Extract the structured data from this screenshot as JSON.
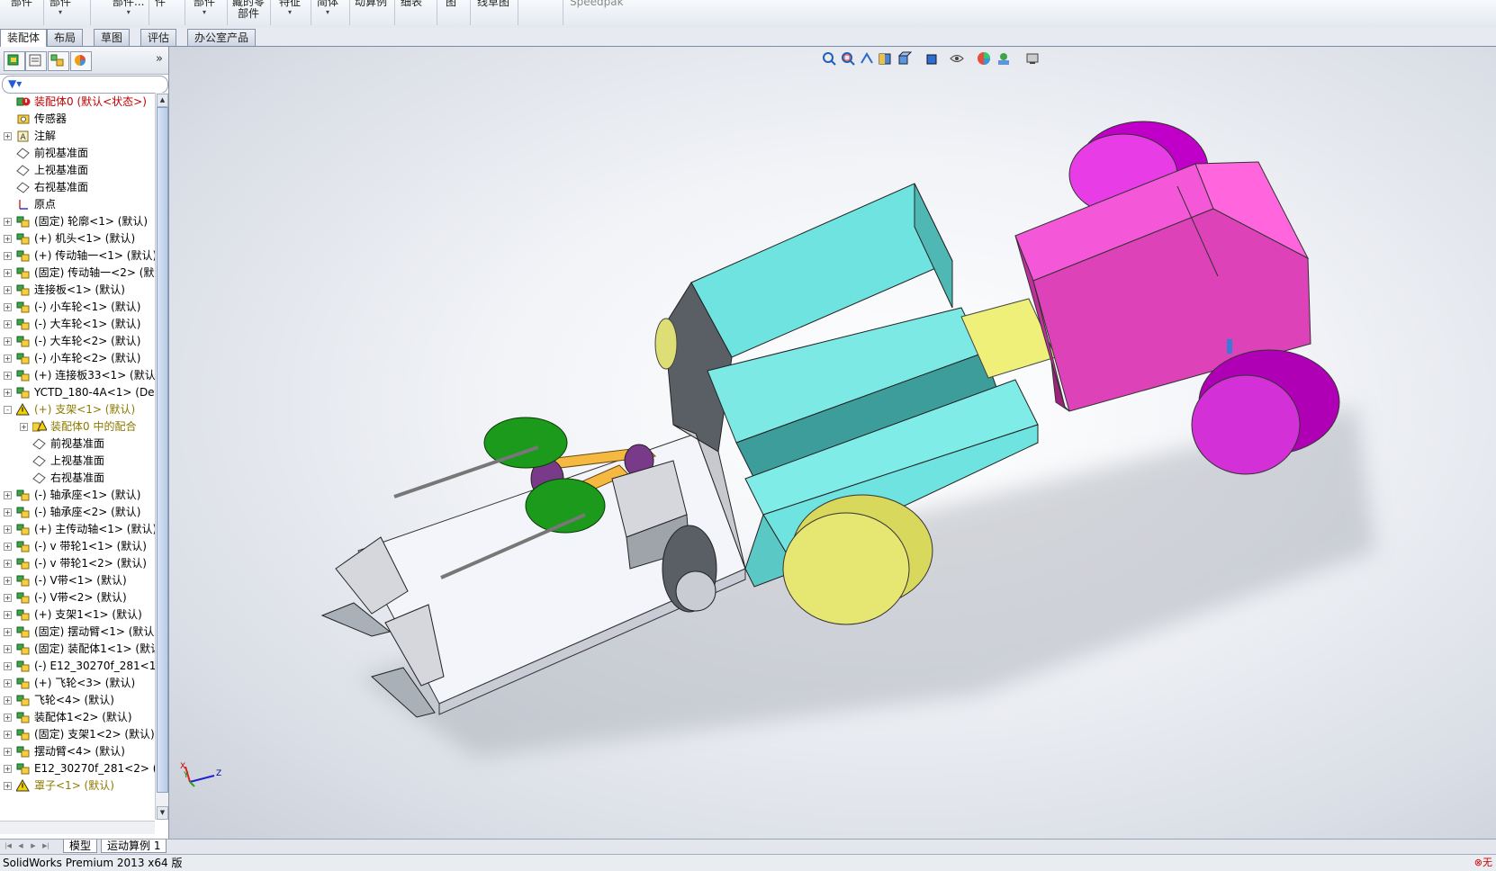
{
  "ribbon": {
    "items": [
      {
        "label": "部件",
        "arrow": ""
      },
      {
        "label": "部件",
        "arrow": "▾"
      },
      {
        "label": "部件...",
        "arrow": "▾"
      },
      {
        "label": "件",
        "arrow": ""
      },
      {
        "label": "部件",
        "arrow": "▾"
      },
      {
        "label": "藏的零\n部件",
        "arrow": ""
      },
      {
        "label": "特征",
        "arrow": "▾"
      },
      {
        "label": "简体",
        "arrow": "▾"
      },
      {
        "label": "动算例",
        "arrow": ""
      },
      {
        "label": "细表",
        "arrow": ""
      },
      {
        "label": "图",
        "arrow": ""
      },
      {
        "label": "线草图",
        "arrow": ""
      },
      {
        "label": "Speedpak",
        "arrow": ""
      }
    ]
  },
  "command_tabs": [
    "装配体",
    "布局",
    "草图",
    "评估",
    "办公室产品"
  ],
  "feature_tree": {
    "rows": [
      {
        "label": "装配体0  (默认<状态>)",
        "icon": "assembly-root-icon",
        "style": "red",
        "expander": ""
      },
      {
        "label": "传感器",
        "icon": "sensor-icon",
        "style": "",
        "expander": ""
      },
      {
        "label": "注解",
        "icon": "annotation-icon",
        "style": "",
        "expander": "+"
      },
      {
        "label": "前视基准面",
        "icon": "plane-icon",
        "style": "",
        "expander": ""
      },
      {
        "label": "上视基准面",
        "icon": "plane-icon",
        "style": "",
        "expander": ""
      },
      {
        "label": "右视基准面",
        "icon": "plane-icon",
        "style": "",
        "expander": ""
      },
      {
        "label": "原点",
        "icon": "origin-icon",
        "style": "",
        "expander": ""
      },
      {
        "label": "(固定) 轮廓<1> (默认)",
        "icon": "subassembly-icon",
        "style": "",
        "expander": "+"
      },
      {
        "label": "(+) 机头<1> (默认)",
        "icon": "subassembly-icon",
        "style": "",
        "expander": "+"
      },
      {
        "label": "(+) 传动轴一<1> (默认)",
        "icon": "subassembly-icon",
        "style": "",
        "expander": "+"
      },
      {
        "label": "(固定) 传动轴一<2> (默",
        "icon": "subassembly-icon",
        "style": "",
        "expander": "+"
      },
      {
        "label": "连接板<1> (默认)",
        "icon": "subassembly-icon",
        "style": "",
        "expander": "+"
      },
      {
        "label": "(-) 小车轮<1> (默认)",
        "icon": "subassembly-icon",
        "style": "",
        "expander": "+"
      },
      {
        "label": "(-) 大车轮<1> (默认)",
        "icon": "subassembly-icon",
        "style": "",
        "expander": "+"
      },
      {
        "label": "(-) 大车轮<2> (默认)",
        "icon": "subassembly-icon",
        "style": "",
        "expander": "+"
      },
      {
        "label": "(-) 小车轮<2> (默认)",
        "icon": "subassembly-icon",
        "style": "",
        "expander": "+"
      },
      {
        "label": "(+) 连接板33<1> (默认)",
        "icon": "subassembly-icon",
        "style": "",
        "expander": "+"
      },
      {
        "label": "YCTD_180-4A<1> (Def",
        "icon": "subassembly-icon",
        "style": "",
        "expander": "+"
      },
      {
        "label": "(+) 支架<1> (默认)",
        "icon": "warning-assembly-icon",
        "style": "warn",
        "expander": "-"
      },
      {
        "label": "装配体0 中的配合",
        "icon": "mates-warning-icon",
        "style": "warn",
        "expander": "+",
        "indent": 1
      },
      {
        "label": "前视基准面",
        "icon": "plane-icon",
        "style": "",
        "expander": "",
        "indent": 1
      },
      {
        "label": "上视基准面",
        "icon": "plane-icon",
        "style": "",
        "expander": "",
        "indent": 1
      },
      {
        "label": "右视基准面",
        "icon": "plane-icon",
        "style": "",
        "expander": "",
        "indent": 1
      },
      {
        "label": "(-) 轴承座<1> (默认)",
        "icon": "subassembly-icon",
        "style": "",
        "expander": "+"
      },
      {
        "label": "(-) 轴承座<2> (默认)",
        "icon": "subassembly-icon",
        "style": "",
        "expander": "+"
      },
      {
        "label": "(+) 主传动轴<1> (默认)",
        "icon": "subassembly-icon",
        "style": "",
        "expander": "+"
      },
      {
        "label": "(-) v 带轮1<1> (默认)",
        "icon": "subassembly-icon",
        "style": "",
        "expander": "+"
      },
      {
        "label": "(-) v 带轮1<2> (默认)",
        "icon": "subassembly-icon",
        "style": "",
        "expander": "+"
      },
      {
        "label": "(-) V带<1> (默认)",
        "icon": "subassembly-icon",
        "style": "",
        "expander": "+"
      },
      {
        "label": "(-) V带<2> (默认)",
        "icon": "subassembly-icon",
        "style": "",
        "expander": "+"
      },
      {
        "label": "(+) 支架1<1> (默认)",
        "icon": "subassembly-icon",
        "style": "",
        "expander": "+"
      },
      {
        "label": "(固定) 摆动臂<1> (默认",
        "icon": "subassembly-icon",
        "style": "",
        "expander": "+"
      },
      {
        "label": "(固定) 装配体1<1> (默认",
        "icon": "subassembly-icon",
        "style": "",
        "expander": "+"
      },
      {
        "label": "(-) E12_30270f_281<1>",
        "icon": "subassembly-icon",
        "style": "",
        "expander": "+"
      },
      {
        "label": "(+) 飞轮<3> (默认)",
        "icon": "subassembly-icon",
        "style": "",
        "expander": "+"
      },
      {
        "label": "飞轮<4> (默认)",
        "icon": "subassembly-icon",
        "style": "",
        "expander": "+"
      },
      {
        "label": "装配体1<2> (默认)",
        "icon": "subassembly-icon",
        "style": "",
        "expander": "+"
      },
      {
        "label": "(固定) 支架1<2> (默认)",
        "icon": "subassembly-icon",
        "style": "",
        "expander": "+"
      },
      {
        "label": "摆动臂<4> (默认)",
        "icon": "subassembly-icon",
        "style": "",
        "expander": "+"
      },
      {
        "label": "E12_30270f_281<2> (",
        "icon": "subassembly-icon",
        "style": "",
        "expander": "+"
      },
      {
        "label": "罩子<1> (默认)",
        "icon": "warning-assembly-icon",
        "style": "warn",
        "expander": "+"
      }
    ]
  },
  "bottom_tabs": [
    "模型",
    "运动算例 1"
  ],
  "status": {
    "text": "SolidWorks Premium 2013 x64 版",
    "error_mark": "⊗无"
  },
  "triad": {
    "x": "X",
    "y": "Y",
    "z": "Z"
  },
  "colors": {
    "cyan_body": "#7eeeea",
    "magenta_body": "#f050c8",
    "yellow_wheel": "#e8e878",
    "green_pulley": "#1f9a1f",
    "orange_belt": "#f5b840"
  }
}
